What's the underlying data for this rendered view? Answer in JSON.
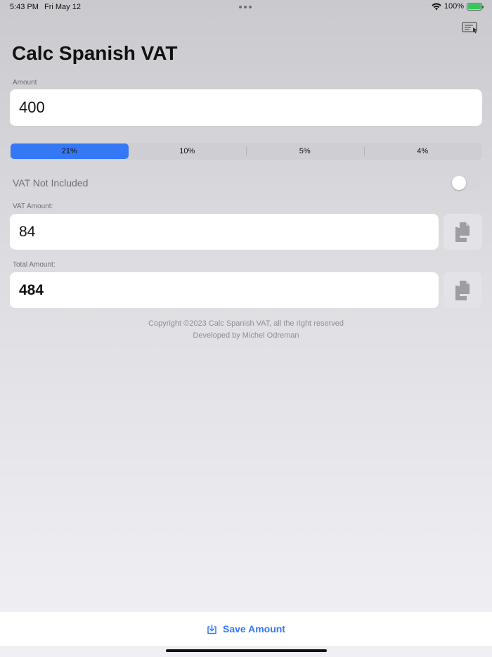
{
  "status_bar": {
    "time": "5:43 PM",
    "date": "Fri May 12",
    "battery": "100%"
  },
  "icons": {
    "reader": "text-cursor-icon",
    "copy": "copy-icon",
    "save": "save-download-icon",
    "wifi": "wifi-icon",
    "battery": "battery-charging-icon"
  },
  "page": {
    "title": "Calc Spanish VAT"
  },
  "amount": {
    "label": "Amount",
    "value": "400"
  },
  "vat_rates": {
    "options": [
      "21%",
      "10%",
      "5%",
      "4%"
    ],
    "selected": "21%"
  },
  "vat_included_toggle": {
    "label": "VAT Not Included",
    "state": "off"
  },
  "vat_amount": {
    "label": "VAT Amount:",
    "value": "84"
  },
  "total_amount": {
    "label": "Total Amount:",
    "value": "484"
  },
  "footer": {
    "copyright": "Copyright ©2023 Calc Spanish VAT, all the right reserved",
    "developer": "Developed by Michel Odreman"
  },
  "bottom_bar": {
    "save_label": "Save Amount"
  },
  "colors": {
    "accent": "#3478f6",
    "toggle_off": "#d6d6da",
    "battery": "#34c759"
  }
}
